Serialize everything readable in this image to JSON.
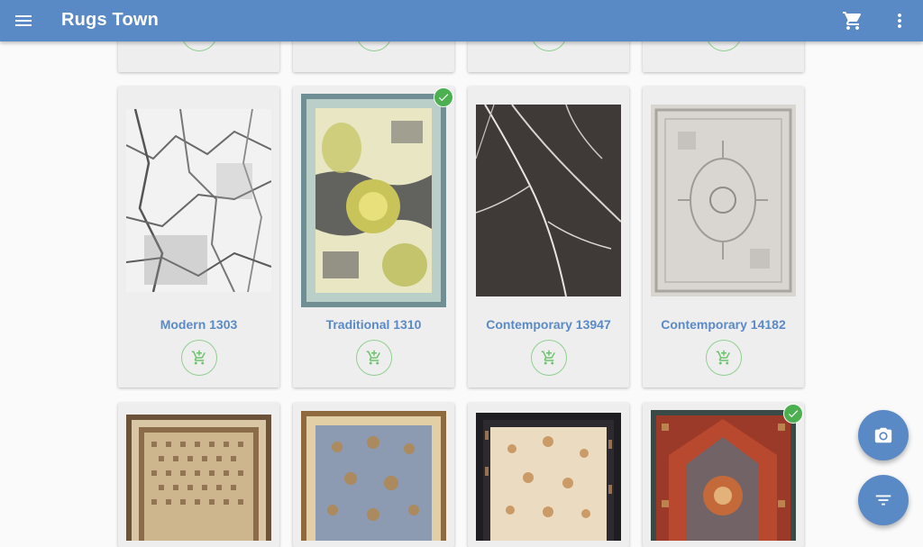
{
  "appbar": {
    "title": "Rugs Town",
    "menu_icon": "menu-icon",
    "cart_icon": "shopping-cart-icon",
    "more_icon": "more-vert-icon"
  },
  "products_row2": [
    {
      "name": "Modern 1303",
      "selected": false
    },
    {
      "name": "Traditional 1310",
      "selected": true
    },
    {
      "name": "Contemporary 13947",
      "selected": false
    },
    {
      "name": "Contemporary 14182",
      "selected": false
    }
  ],
  "products_row3_selected": [
    false,
    false,
    false,
    true
  ],
  "fabs": {
    "camera_icon": "camera-icon",
    "filter_icon": "filter-icon"
  },
  "colors": {
    "primary": "#5a8ac6",
    "accent_green": "#4caf50",
    "add_cart_green": "#8fd08f"
  }
}
